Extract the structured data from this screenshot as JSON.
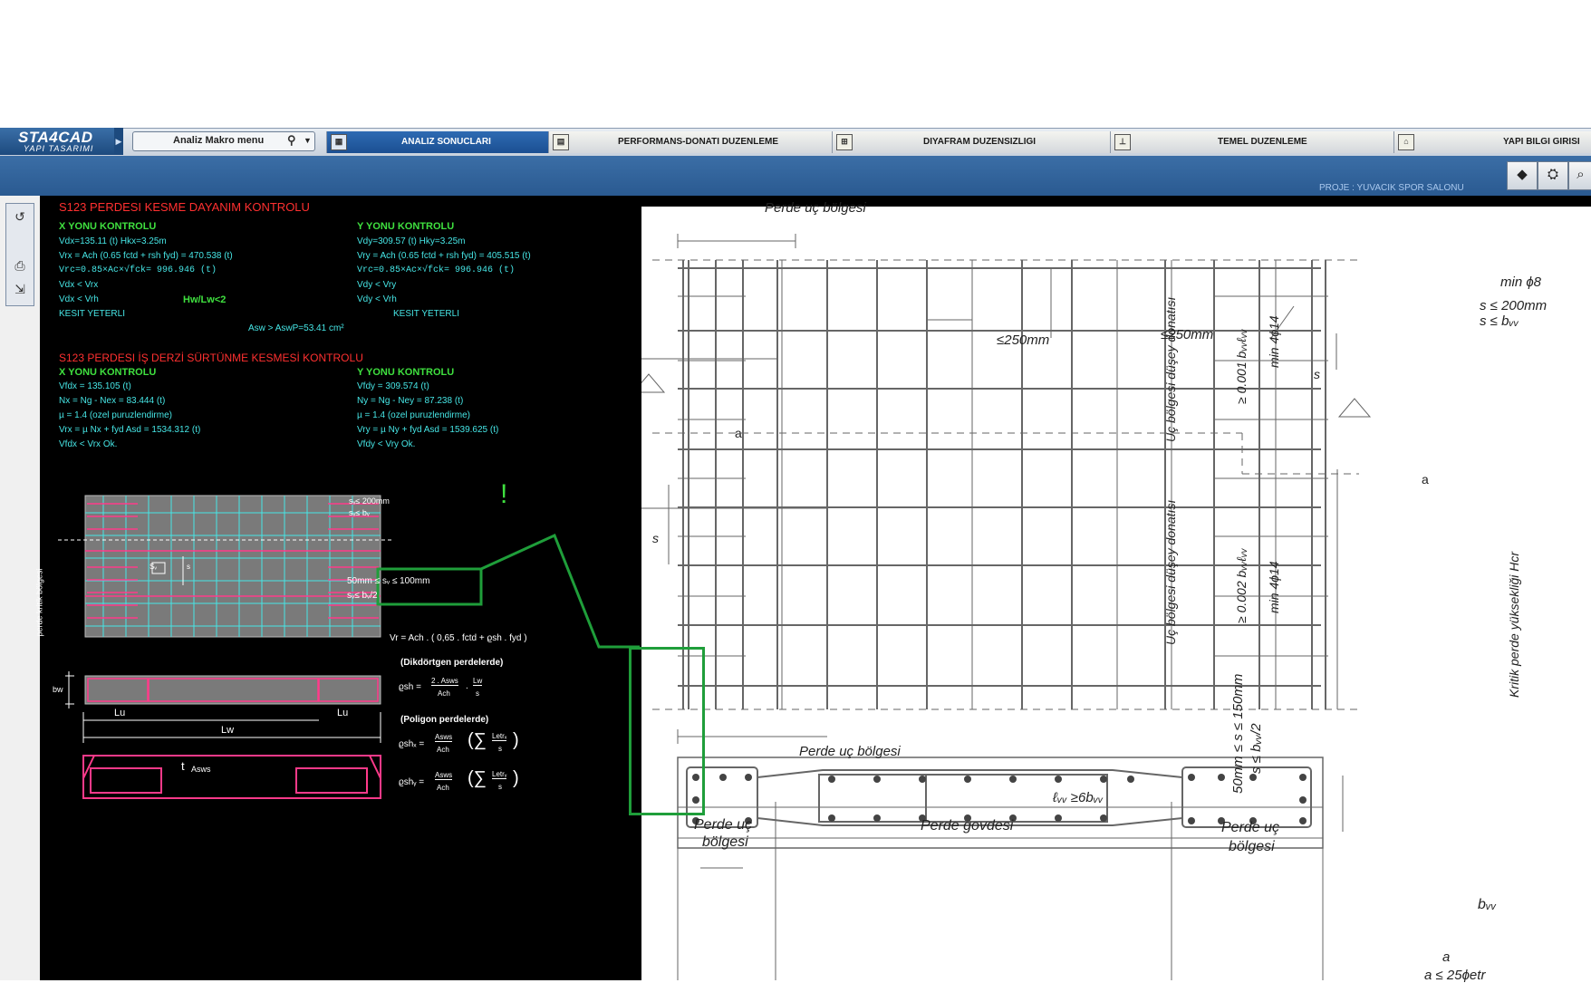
{
  "app": {
    "logo_title": "STA4CAD",
    "logo_subtitle": "YAPI TASARIMI",
    "macro_menu": "Analiz Makro menu",
    "project": "PROJE : YUVACIK SPOR SALONU"
  },
  "tabs": [
    {
      "label": "ANALIZ SONUCLARI",
      "icon": "table-icon"
    },
    {
      "label": "PERFORMANS-DONATI DUZENLEME",
      "icon": "performance-icon"
    },
    {
      "label": "DIYAFRAM DUZENSIZLIGI",
      "icon": "diaphragm-icon"
    },
    {
      "label": "TEMEL DUZENLEME",
      "icon": "foundation-icon"
    },
    {
      "label": "YAPI BILGI GIRISI",
      "icon": "building-info-icon"
    }
  ],
  "colors": {
    "accent": "#2e6bb3",
    "panel": "#000000",
    "red": "#ff3030",
    "green": "#3fe03f",
    "cyan": "#46e6e6",
    "highlight": "#1f9e3a"
  },
  "report": {
    "shear_title": "S123 PERDESI KESME DAYANIM KONTROLU",
    "x_head": "X YONU KONTROLU",
    "y_head": "Y YONU KONTROLU",
    "x_lines": [
      "Vdx=135.11 (t)    Hkx=3.25m",
      "Vrx = Ach (0.65  fctd + rsh fyd) =    470.538 (t)",
      "Vrc=0.85×Ac×√fck=    996.946 (t)",
      "Vdx < Vrx",
      "Vdx < Vrh",
      "KESIT YETERLI"
    ],
    "y_lines": [
      "Vdy=309.57 (t)    Hky=3.25m",
      "Vry = Ach (0.65  fctd + rsh fyd) =    405.515 (t)",
      "Vrc=0.85×Ac×√fck=    996.946 (t)",
      "Vdy < Vry",
      "Vdy < Vrh",
      "KESIT YETERLI"
    ],
    "hw_lw": "Hw/Lw<2",
    "asw": "Asw > AswP=53.41 cm²",
    "joint_title": "S123 PERDESI İŞ DERZİ SÜRTÜNME KESMESİ KONTROLU",
    "jx_lines": [
      "Vfdx =    135.105 (t)",
      "Nx = Ng - Nex =     83.444 (t)",
      "µ = 1.4 (ozel puruzlendirme)",
      "Vrx = µ Nx + fyd Asd =   1534.312 (t)",
      "Vfdx < Vrx   Ok."
    ],
    "jy_lines": [
      "Vfdy =    309.574 (t)",
      "Ny = Ng - Ney =     87.238 (t)",
      "µ = 1.4 (ozel puruzlendirme)",
      "Vry = µ Ny + fyd Asd =   1539.625 (t)",
      "Vfdy < Vry   Ok."
    ]
  },
  "sketch": {
    "sv_top1": "sᵥ≤ 200mm",
    "sv_top2": "sᵥ≤ bᵥ",
    "box_line1": "50mm  ≤ sᵥ ≤ 100mm",
    "box_line2": "sᵥ≤ bᵥ/2",
    "side_label": "perde kritik bölgesi",
    "sv_label": "Sᵥ",
    "s_label": "s",
    "vr_formula": "Vr = Ach . ( 0,65 . fctd  +  ϱsh . fyd )",
    "rect_head": "(Dikdörtgen perdelerde)",
    "rho_rect": "ϱsh =",
    "frac1_top": "2 . Asws",
    "frac1_bot": "Ach",
    "dot": ".",
    "frac2_top": "Lw",
    "frac2_bot": "s",
    "poly_head": "(Poligon perdelerde)",
    "rho_x": "ϱshₓ =",
    "rho_y": "ϱshᵧ =",
    "frac_top": "Asws",
    "frac_bot": "Ach",
    "sum_x_top": "Letrₓ",
    "sum_y_top": "Letrᵧ",
    "sum_bot": "s",
    "bw": "bw",
    "lu1": "Lu",
    "lu2": "Lu",
    "lw": "Lw",
    "t": "t",
    "asws": "Asws",
    "exclaim": "!"
  },
  "drawing": {
    "top_label": "Perde uç bölgesi",
    "min_phi8": "min ϕ8",
    "s200": "s ≤ 200mm",
    "sbw": "s ≤ bᵥᵥ",
    "s_right": "s",
    "le250a": "≤250mm",
    "le250b": "≤250mm",
    "sec_a1": "a",
    "sec_a2": "a",
    "vert1": "Uç bölgesi düşey donatısı",
    "vert1b": "≥ 0.001 bᵥᵥℓᵥᵥ",
    "min414a": "min 4ϕ14",
    "vert2": "Uç bölgesi düşey donatısı",
    "vert2b": "≥ 0.002 bᵥᵥℓᵥᵥ",
    "min414b": "min 4ϕ14",
    "s_left": "s",
    "box_rot1": "50mm ≤ s ≤ 150mm",
    "box_rot2": "s ≤ bᵥᵥ/2",
    "hcr": "Kritik perde yüksekliği Hcr",
    "bottom_label": "Perde uç bölgesi",
    "lw6bw": "ℓᵥᵥ ≥6bᵥᵥ",
    "end1a": "Perde uç",
    "end1b": "bölgesi",
    "body": "Perde govdesi",
    "end2a": "Perde uç",
    "end2b": "bölgesi",
    "bw_sec": "bᵥᵥ",
    "a_dim": "a",
    "a_le": "a ≤ 25ϕetr"
  }
}
